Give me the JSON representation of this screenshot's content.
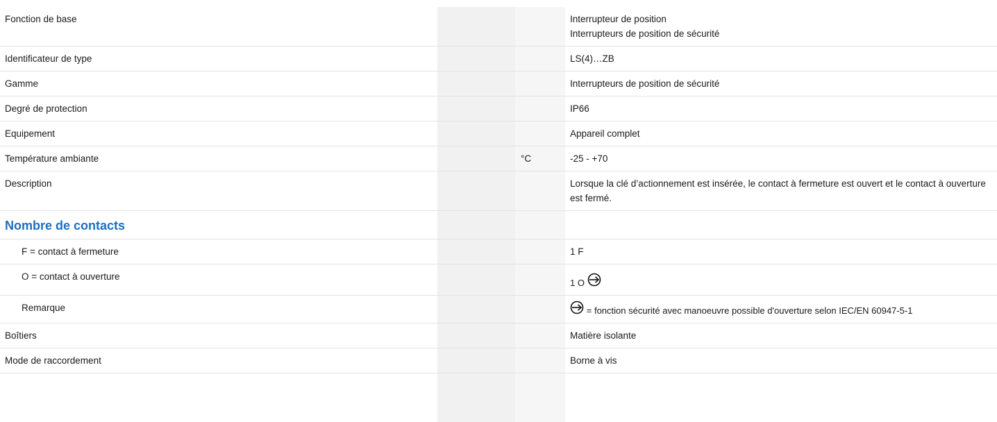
{
  "rows": [
    {
      "label": "Fonction de base",
      "unit": "",
      "value_lines": [
        "Interrupteur de position",
        "Interrupteurs de position de sécurité"
      ]
    },
    {
      "label": "Identificateur de type",
      "unit": "",
      "value": "LS(4)…ZB"
    },
    {
      "label": "Gamme",
      "unit": "",
      "value": "Interrupteurs de position de sécurité"
    },
    {
      "label": "Degré de protection",
      "unit": "",
      "value": "IP66"
    },
    {
      "label": "Equipement",
      "unit": "",
      "value": "Appareil complet"
    },
    {
      "label": "Température ambiante",
      "unit": "°C",
      "value": "-25 - +70"
    },
    {
      "label": "Description",
      "unit": "",
      "value": "Lorsque la clé d’actionnement est insérée, le contact à fermeture est ouvert et le contact à ouverture est fermé."
    }
  ],
  "section": {
    "title": "Nombre de contacts",
    "rows": [
      {
        "label": "F = contact à fermeture",
        "value": "1 F"
      },
      {
        "label": "O = contact à ouverture",
        "value": "1 O",
        "icon": "safety-positive-opening-icon"
      },
      {
        "label": "Remarque",
        "icon": "safety-positive-opening-icon",
        "value": "= fonction sécurité avec manoeuvre possible d'ouverture selon IEC/EN 60947-5-1"
      }
    ]
  },
  "rows_after": [
    {
      "label": "Boîtiers",
      "unit": "",
      "value": "Matière isolante"
    },
    {
      "label": "Mode de raccordement",
      "unit": "",
      "value": "Borne à vis"
    }
  ]
}
